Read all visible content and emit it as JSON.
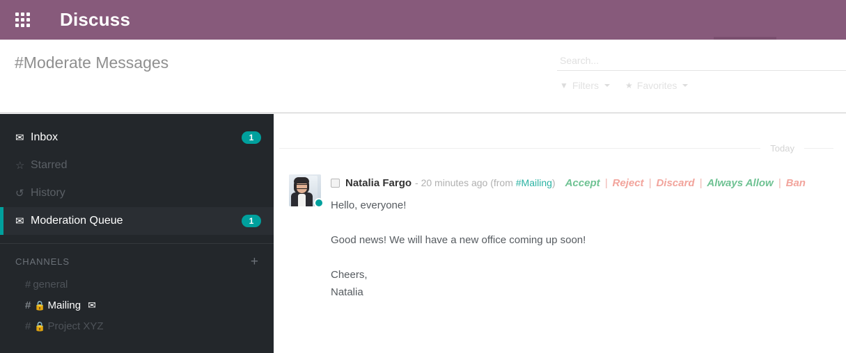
{
  "topbar": {
    "apps_icon": "grid-apps-icon",
    "title": "Discuss"
  },
  "control_panel": {
    "breadcrumb": "#Moderate Messages",
    "search": {
      "value": "",
      "placeholder": "Search..."
    },
    "dropdowns": [
      {
        "label": "Filters",
        "icon": "filter-funnel-icon"
      },
      {
        "label": "Favorites",
        "icon": "star-icon"
      }
    ]
  },
  "sidebar": {
    "mailboxes": [
      {
        "label": "Inbox",
        "icon": "inbox-tray-icon",
        "badge": "1",
        "active": false,
        "bright": true
      },
      {
        "label": "Starred",
        "icon": "star-outline-icon",
        "badge": "",
        "active": false,
        "bright": false
      },
      {
        "label": "History",
        "icon": "history-clock-icon",
        "badge": "",
        "active": false,
        "bright": false
      },
      {
        "label": "Moderation Queue",
        "icon": "envelope-icon",
        "badge": "1",
        "active": true,
        "bright": true
      }
    ],
    "channels_section": {
      "title": "CHANNELS",
      "add_label": "+",
      "items": [
        {
          "hash": "#",
          "label": "general",
          "private": false,
          "moderated": false,
          "active": false
        },
        {
          "hash": "#",
          "label": "Mailing",
          "private": true,
          "moderated": true,
          "active": true
        },
        {
          "hash": "#",
          "label": "Project XYZ",
          "private": true,
          "moderated": false,
          "active": false
        }
      ]
    }
  },
  "thread": {
    "day_separator": "Today",
    "message": {
      "author": "Natalia Fargo",
      "meta_prefix": "- 20 minutes ago (from ",
      "channel_link": "#Mailing",
      "meta_suffix": ")",
      "actions": [
        {
          "label": "Accept",
          "style": "green"
        },
        {
          "label": "Reject",
          "style": "red"
        },
        {
          "label": "Discard",
          "style": "red"
        },
        {
          "label": "Always Allow",
          "style": "green"
        },
        {
          "label": "Ban",
          "style": "red"
        }
      ],
      "separator": "|",
      "body": "Hello, everyone!\n\nGood news! We will have a new office coming up soon!\n\nCheers,\nNatalia",
      "avatar": "user-photo-avatar",
      "status": "online"
    }
  },
  "colors": {
    "brand_purple": "#875A7B",
    "accent_teal": "#00A09D",
    "sidebar_bg": "#23272b",
    "action_green": "#6fc293",
    "action_red": "#f2a49c"
  }
}
